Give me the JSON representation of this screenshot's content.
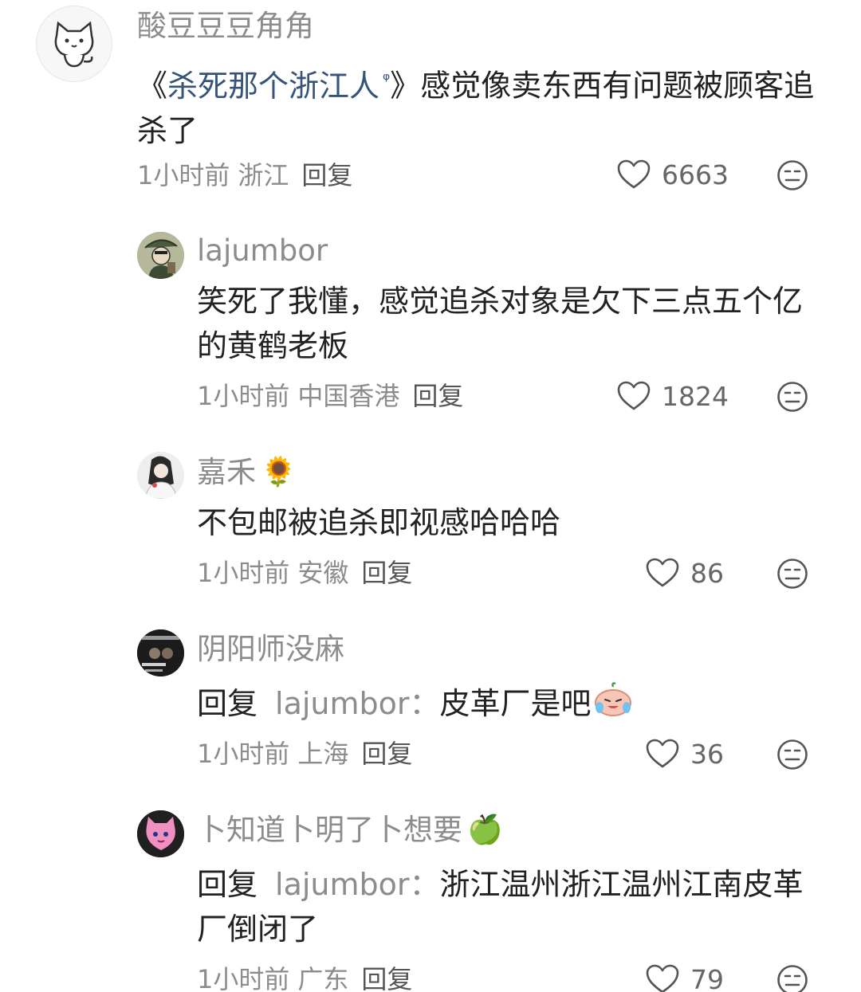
{
  "comments": [
    {
      "username": "酸豆豆豆角角",
      "body_prefix": "《",
      "body_link": "杀死那个浙江人",
      "body_suffix": "》感觉像卖东西有问题被顾客追杀了",
      "time": "1小时前",
      "location": "浙江",
      "reply_label": "回复",
      "likes": "6663"
    },
    {
      "username": "lajumbor",
      "body": "笑死了我懂，感觉追杀对象是欠下三点五个亿的黄鹤老板",
      "time": "1小时前",
      "location": "中国香港",
      "reply_label": "回复",
      "likes": "1824"
    },
    {
      "username": "嘉禾",
      "username_emoji": "🌻",
      "body": "不包邮被追杀即视感哈哈哈",
      "time": "1小时前",
      "location": "安徽",
      "reply_label": "回复",
      "likes": "86"
    },
    {
      "username": "阴阳师没麻",
      "reply_prefix": "回复",
      "reply_target": "lajumbor：",
      "body": "皮革厂是吧",
      "time": "1小时前",
      "location": "上海",
      "reply_label": "回复",
      "likes": "36"
    },
    {
      "username": "卜知道卜明了卜想要",
      "username_emoji": "🍏",
      "reply_prefix": "回复",
      "reply_target": "lajumbor：",
      "body": "浙江温州浙江温州江南皮革厂倒闭了",
      "time": "1小时前",
      "location": "广东",
      "reply_label": "回复",
      "likes": "79"
    }
  ],
  "colors": {
    "meta": "#8c8c8c",
    "link": "#36547a",
    "text": "#222222"
  },
  "icons": {
    "like": "heart-outline-icon",
    "dislike": "meh-face-icon",
    "search": "search-icon"
  }
}
